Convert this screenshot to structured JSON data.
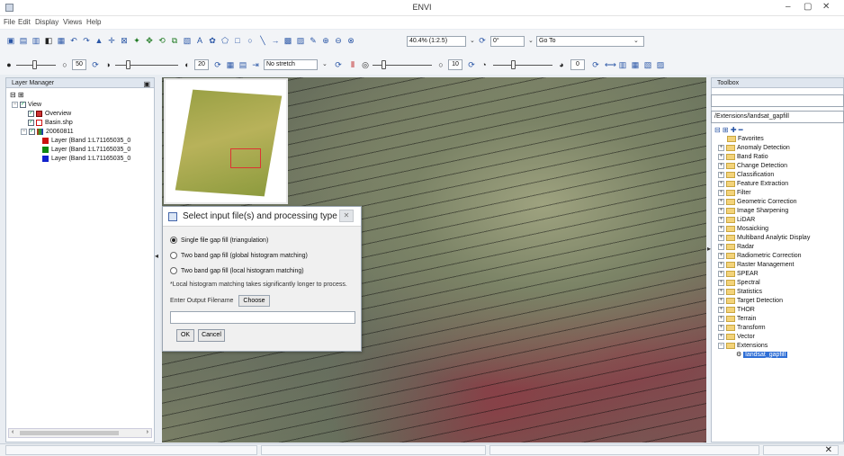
{
  "window": {
    "title": "ENVI",
    "min": "–",
    "max": "▢",
    "close": "✕"
  },
  "menu": [
    "File",
    "Edit",
    "Display",
    "Views",
    "Help"
  ],
  "toolbar": {
    "zoom_value": "40.4% (1:2.5)",
    "rotation_value": "0°",
    "goto_label": "Go To"
  },
  "toolbar2": {
    "brightness": "50",
    "contrast": "20",
    "stretch_value": "No stretch",
    "sharpen": "10",
    "transparency": "0"
  },
  "layer_manager": {
    "title": "Layer Manager",
    "items": [
      {
        "label": "View",
        "indent": 0
      },
      {
        "label": "Overview",
        "indent": 1
      },
      {
        "label": "Basin.shp",
        "indent": 1
      },
      {
        "label": "20060811",
        "indent": 1
      },
      {
        "label": "Layer (Band 1:L71165035_0",
        "indent": 2,
        "color": "#cc1111"
      },
      {
        "label": "Layer (Band 1:L71165035_0",
        "indent": 2,
        "color": "#118811"
      },
      {
        "label": "Layer (Band 1:L71165035_0",
        "indent": 2,
        "color": "#1122cc"
      }
    ]
  },
  "dialog": {
    "title": "Select input file(s) and processing type",
    "options": [
      "Single file gap fill (triangulation)",
      "Two band gap fill (global histogram matching)",
      "Two band gap fill (local histogram matching)"
    ],
    "selected_index": 0,
    "note": "*Local histogram matching takes significantly longer to process.",
    "output_label": "Enter Output Filename",
    "choose_label": "Choose",
    "ok_label": "OK",
    "cancel_label": "Cancel"
  },
  "toolbox": {
    "title": "Toolbox",
    "path": "/Extensions/landsat_gapfill",
    "items": [
      "Favorites",
      "Anomaly Detection",
      "Band Ratio",
      "Change Detection",
      "Classification",
      "Feature Extraction",
      "Filter",
      "Geometric Correction",
      "Image Sharpening",
      "LiDAR",
      "Mosaicking",
      "Multiband Analytic Display",
      "Radar",
      "Radiometric Correction",
      "Raster Management",
      "SPEAR",
      "Spectral",
      "Statistics",
      "Target Detection",
      "THOR",
      "Terrain",
      "Transform",
      "Vector",
      "Extensions"
    ],
    "selected_tool": "landsat_gapfill"
  }
}
